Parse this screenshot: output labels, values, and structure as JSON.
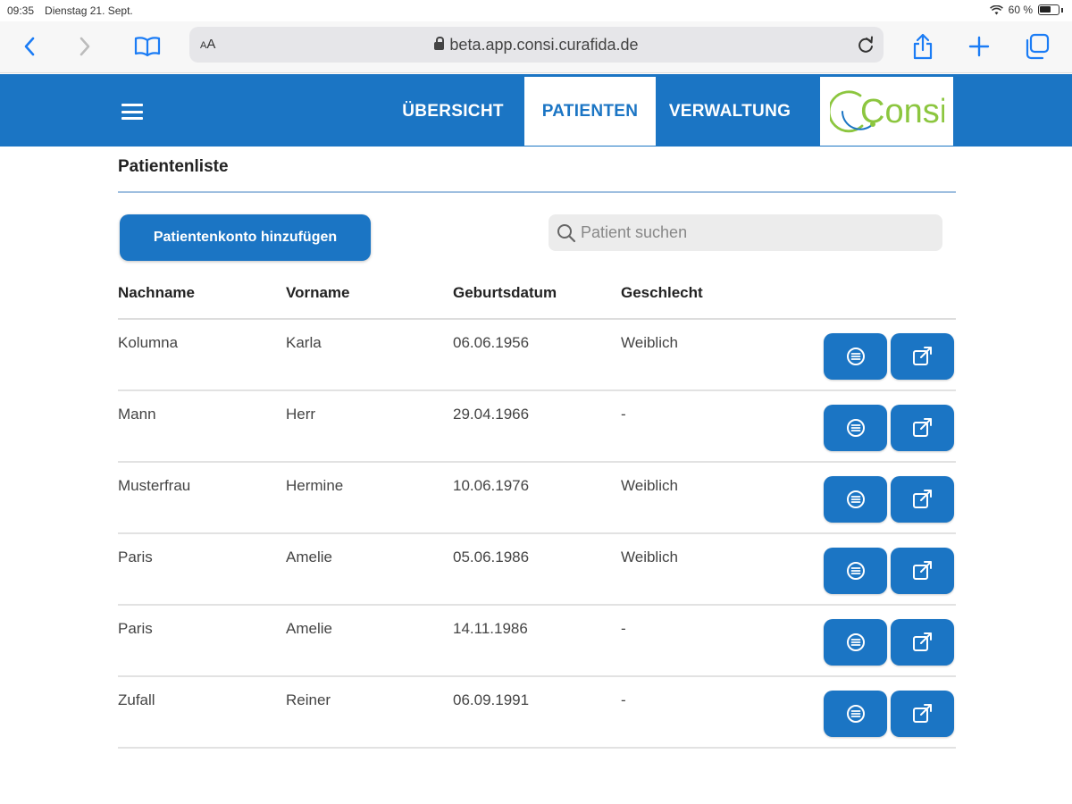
{
  "status_bar": {
    "time": "09:35",
    "date": "Dienstag 21. Sept.",
    "battery": "60 %"
  },
  "browser": {
    "text_size": "AA",
    "url": "beta.app.consi.curafida.de"
  },
  "nav": {
    "tabs": [
      {
        "label": "ÜBERSICHT"
      },
      {
        "label": "PATIENTEN"
      },
      {
        "label": "VERWALTUNG"
      }
    ],
    "active_tab": "PATIENTEN",
    "logo_text": "Consi"
  },
  "page": {
    "title": "Patientenliste",
    "add_button": "Patientenkonto hinzufügen",
    "search_placeholder": "Patient suchen"
  },
  "table": {
    "headers": [
      "Nachname",
      "Vorname",
      "Geburtsdatum",
      "Geschlecht"
    ],
    "rows": [
      {
        "last": "Kolumna",
        "first": "Karla",
        "birth": "06.06.1956",
        "gender": "Weiblich"
      },
      {
        "last": "Mann",
        "first": "Herr",
        "birth": "29.04.1966",
        "gender": "-"
      },
      {
        "last": "Musterfrau",
        "first": "Hermine",
        "birth": "10.06.1976",
        "gender": "Weiblich"
      },
      {
        "last": "Paris",
        "first": "Amelie",
        "birth": "05.06.1986",
        "gender": "Weiblich"
      },
      {
        "last": "Paris",
        "first": "Amelie",
        "birth": "14.11.1986",
        "gender": "-"
      },
      {
        "last": "Zufall",
        "first": "Reiner",
        "birth": "06.09.1991",
        "gender": "-"
      }
    ]
  },
  "colors": {
    "primary": "#1b75c4",
    "logo_green": "#8cc63f"
  }
}
